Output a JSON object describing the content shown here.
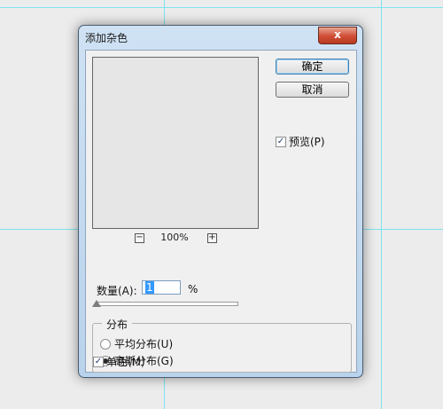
{
  "dialog": {
    "title": "添加杂色",
    "close_glyph": "x",
    "ok_label": "确定",
    "cancel_label": "取消",
    "preview_label": "预览(P)",
    "preview_checked": true,
    "zoom_minus": "−",
    "zoom_plus": "+",
    "zoom_level": "100%",
    "amount_label": "数量(A):",
    "amount_value": "1",
    "amount_unit": "%",
    "amount_slider_value": 1,
    "distribution_title": "分布",
    "uniform_label": "平均分布(U)",
    "gaussian_label": "高斯分布(G)",
    "selected_distribution": "gaussian",
    "monochromatic_label": "单色(M)",
    "monochromatic_checked": true,
    "check_glyph": "✓"
  },
  "colors": {
    "guide_line": "#7fe3ef",
    "title_bar": "#cfe2f4",
    "close_button": "#cf4d34",
    "selection": "#3399ff"
  },
  "icons": [
    "close-icon",
    "zoom-out-icon",
    "zoom-in-icon",
    "checkmark-icon",
    "slider-thumb-icon"
  ]
}
